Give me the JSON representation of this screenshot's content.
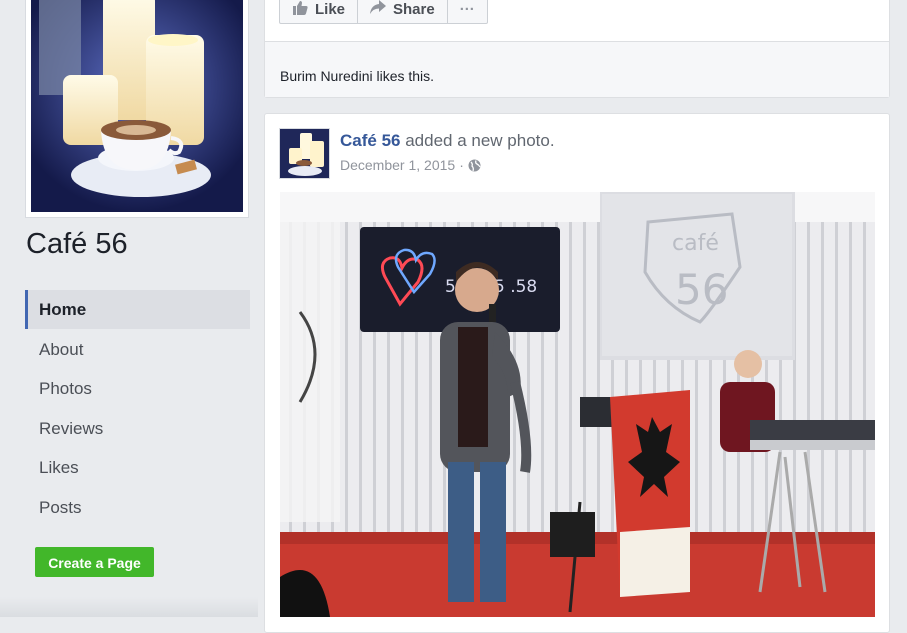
{
  "page": {
    "name": "Café 56",
    "cover_icon": "cafe-candles-photo"
  },
  "nav": {
    "items": [
      {
        "label": "Home",
        "active": true
      },
      {
        "label": "About",
        "active": false
      },
      {
        "label": "Photos",
        "active": false
      },
      {
        "label": "Reviews",
        "active": false
      },
      {
        "label": "Likes",
        "active": false
      },
      {
        "label": "Posts",
        "active": false
      }
    ]
  },
  "create_page_label": "Create a Page",
  "prev_post": {
    "like_label": "Like",
    "share_label": "Share",
    "more_label": "···",
    "likes_text": "Burim Nuredini likes this."
  },
  "post": {
    "author": "Café 56",
    "action": "added a new photo.",
    "date": "December 1, 2015",
    "separator": "·",
    "privacy_icon": "globe-icon",
    "photo_screen_text": "café 56",
    "photo_led_text": "5/2015 .58"
  },
  "colors": {
    "accent": "#4267b2",
    "link": "#365899",
    "create_button": "#42b72a",
    "background": "#e9ebee"
  }
}
